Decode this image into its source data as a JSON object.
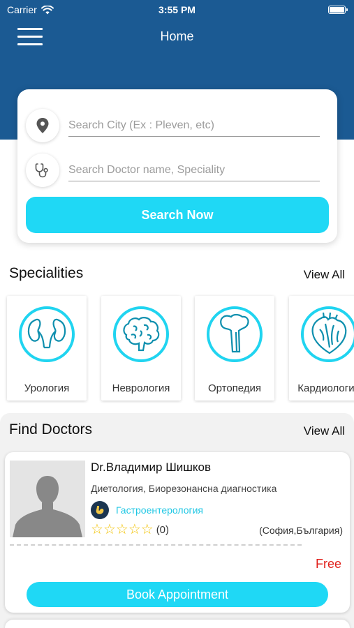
{
  "status_bar": {
    "carrier": "Carrier",
    "time": "3:55 PM",
    "wifi_icon": "wifi-icon",
    "battery_level": 1.0
  },
  "nav": {
    "title": "Home",
    "menu_icon": "hamburger-menu-icon"
  },
  "search": {
    "city_placeholder": "Search City (Ex : Pleven, etc)",
    "city_icon": "location-pin-icon",
    "doctor_placeholder": "Search Doctor name, Speciality",
    "doctor_icon": "stethoscope-icon",
    "button_label": "Search Now"
  },
  "specialities": {
    "title": "Specialities",
    "view_all": "View All",
    "items": [
      {
        "label": "Урология",
        "icon": "kidneys-icon"
      },
      {
        "label": "Неврология",
        "icon": "brain-icon"
      },
      {
        "label": "Ортопедия",
        "icon": "bone-icon"
      },
      {
        "label": "Кардиология",
        "icon": "heart-icon"
      }
    ]
  },
  "find_doctors": {
    "title": "Find Doctors",
    "view_all": "View All",
    "doctors": [
      {
        "name": "Dr.Владимир Шишков",
        "description": "Диетология, Биорезонансна диагностика",
        "speciality": "Гастроентерология",
        "rating_stars": 0,
        "rating_count": "(0)",
        "location": "(София,България)",
        "price": "Free",
        "book_label": "Book Appointment"
      }
    ]
  },
  "colors": {
    "header_blue": "#1b5a93",
    "accent_cyan": "#1fd8f5",
    "price_red": "#e0201b",
    "star_yellow": "#f2c200"
  }
}
